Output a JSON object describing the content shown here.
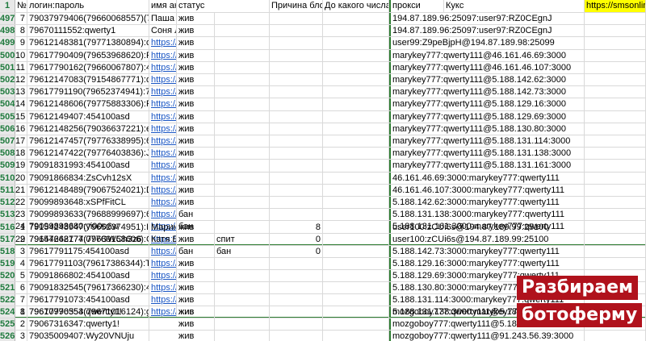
{
  "header": {
    "row_num": "1",
    "num": "№",
    "login": "логин:пароль",
    "name": "имя акка",
    "status": "статус",
    "reason": "Причина блока",
    "until": "До какого числа",
    "proxy": "прокси",
    "cookies": "Кукс",
    "link": "https://smsonline"
  },
  "rows": [
    {
      "rn": "497",
      "num": "7",
      "login": "79037979406(79660068557)(79",
      "name": "Паша",
      "link": "",
      "status": "жив",
      "proxy": "194.87.189.96:25097:user97:RZ0CEgnJ"
    },
    {
      "rn": "498",
      "num": "8",
      "login": "79670111552:qwerty1",
      "name": "Соня Л",
      "link": "",
      "status": "жив",
      "proxy": "194.87.189.96:25097:user97:RZ0CEgnJ"
    },
    {
      "rn": "499",
      "num": "9",
      "login": "79612148381(79771380894):oE",
      "name": "",
      "link": "https://",
      "status": "жив",
      "proxy": "user99:Z9peBjpH@194.87.189.98:25099"
    },
    {
      "rn": "500",
      "num": "10",
      "login": "79617790409(79653968620):Rk",
      "name": "",
      "link": "https://",
      "status": "жив",
      "proxy": "marykey777:qwerty111@46.161.46.69:3000"
    },
    {
      "rn": "501",
      "num": "11",
      "login": "79617790162(79660067807):4g",
      "name": "",
      "link": "https://",
      "status": "жив",
      "proxy": "marykey777:qwerty111@46.161.46.107:3000"
    },
    {
      "rn": "502",
      "num": "12",
      "login": "79612147083(79154867771):qw",
      "name": "",
      "link": "https://",
      "status": "жив",
      "proxy": "marykey777:qwerty111@5.188.142.62:3000"
    },
    {
      "rn": "503",
      "num": "13",
      "login": "79617791190(79652374941):7G",
      "name": "",
      "link": "https://",
      "status": "жив",
      "proxy": "marykey777:qwerty111@5.188.142.73:3000"
    },
    {
      "rn": "504",
      "num": "14",
      "login": "79612148606(79775883306):FX",
      "name": "",
      "link": "https://",
      "status": "жив",
      "proxy": "marykey777:qwerty111@5.188.129.16:3000"
    },
    {
      "rn": "505",
      "num": "15",
      "login": "79612149407:454100asd",
      "name": "",
      "link": "https://",
      "status": "жив",
      "proxy": "marykey777:qwerty111@5.188.129.69:3000"
    },
    {
      "rn": "506",
      "num": "16",
      "login": "79612148256(79036637221):eR",
      "name": "",
      "link": "https://",
      "status": "жив",
      "proxy": "marykey777:qwerty111@5.188.130.80:3000"
    },
    {
      "rn": "507",
      "num": "17",
      "login": "79612147457(79776338995):6O",
      "name": "",
      "link": "https://",
      "status": "жив",
      "proxy": "marykey777:qwerty111@5.188.131.114:3000"
    },
    {
      "rn": "508",
      "num": "18",
      "login": "79612147422(79776403836):Jts",
      "name": "",
      "link": "https://",
      "status": "жив",
      "proxy": "marykey777:qwerty111@5.188.131.138:3000"
    },
    {
      "rn": "509",
      "num": "19",
      "login": "79091831993:454100asd",
      "name": "",
      "link": "https://",
      "status": "жив",
      "proxy": "marykey777:qwerty111@5.188.131.161:3000"
    },
    {
      "rn": "510",
      "num": "20",
      "login": "79091866834:ZsCvh12sX",
      "name": "",
      "link": "https://",
      "status": "жив",
      "proxy": "46.161.46.69:3000:marykey777:qwerty111"
    },
    {
      "rn": "511",
      "num": "21",
      "login": "79612148489(79067524021):D0",
      "name": "",
      "link": "https://",
      "status": "жив",
      "proxy": "46.161.46.107:3000:marykey777:qwerty111"
    },
    {
      "rn": "512",
      "num": "22",
      "login": "79099893648:xSPfFitCL",
      "name": "",
      "link": "https://",
      "status": "жив",
      "proxy": "5.188.142.62:3000:marykey777:qwerty111"
    },
    {
      "rn": "513",
      "num": "23",
      "login": "79099893633(79688999697):6b",
      "name": "",
      "link": "https://",
      "status": "бан",
      "proxy": "5.188.131.138:3000:marykey777:qwerty111"
    },
    {
      "rn": "514",
      "num": "24",
      "login": "79099893680:yi00o6w",
      "name": "",
      "link": "https://",
      "status": "бан",
      "proxy": "5.188.131.161:3000:marykey777:qwerty111"
    },
    {
      "rn": "515",
      "num": "29",
      "login": "79647662774:077GWCh3z6",
      "name": "",
      "link": "https://",
      "status": "",
      "proxy": ""
    }
  ],
  "rows2": [
    {
      "rn": "516",
      "num": "1",
      "login": "79154248947(79652374951):IxA",
      "name": "Марин",
      "link": "",
      "status": "жив",
      "reason": "",
      "until": "8",
      "proxy": "user100:zCUi6s@194.87.189.99:25100"
    },
    {
      "rn": "517",
      "num": "2",
      "login": "79154248177(79689158606):CA",
      "name": "Катя Б",
      "link": "",
      "status": "жив",
      "reason": "спит",
      "until": "0",
      "proxy": "user100:zCUi6s@194.87.189.99:25100"
    },
    {
      "rn": "518",
      "num": "3",
      "login": "79617791175:454100asd",
      "name": "",
      "link": "https://",
      "status": "бан",
      "reason": "бан",
      "until": "0",
      "proxy": "5.188.142.73:3000:marykey777:qwerty111"
    },
    {
      "rn": "519",
      "num": "4",
      "login": "79617791103(79617386344):T9",
      "name": "",
      "link": "https://",
      "status": "жив",
      "reason": "",
      "until": "",
      "proxy": "5.188.129.16:3000:marykey777:qwerty111"
    },
    {
      "rn": "520",
      "num": "5",
      "login": "79091866802:454100asd",
      "name": "",
      "link": "https://",
      "status": "жив",
      "reason": "",
      "until": "",
      "proxy": "5.188.129.69:3000:marykey777:qwerty111"
    },
    {
      "rn": "521",
      "num": "6",
      "login": "79091832545(79617366230):4q",
      "name": "",
      "link": "https://",
      "status": "жив",
      "reason": "",
      "until": "",
      "proxy": "5.188.130.80:3000:marykey777:qwerty111"
    },
    {
      "rn": "522",
      "num": "7",
      "login": "79617791073:454100asd",
      "name": "",
      "link": "https://",
      "status": "жив",
      "reason": "",
      "until": "",
      "proxy": "5.188.131.114:3000:marykey777:qwerty111"
    },
    {
      "rn": "523",
      "num": "8",
      "login": "79617790353(79671016124):gE",
      "name": "",
      "link": "https://",
      "status": "жив",
      "reason": "",
      "until": "",
      "proxy": "5.188.131.138:3000:marykey777:qwerty111"
    }
  ],
  "rows3": [
    {
      "rn": "524",
      "num": "1",
      "login": "79670976554:qwertty1!",
      "name": "",
      "link": "",
      "status": "жив",
      "proxy": "mozgoboy777:qwerty111@5.188.131.161"
    },
    {
      "rn": "525",
      "num": "2",
      "login": "79067316347:qwerty1!",
      "name": "",
      "link": "",
      "status": "жив",
      "proxy": "mozgoboy777:qwerty111@5.188.130.80"
    },
    {
      "rn": "526",
      "num": "3",
      "login": "79035009407:Wy20VNUju",
      "name": "",
      "link": "",
      "status": "жив",
      "proxy": "mozgoboy777:qwerty111@91.243.56.39:3000"
    }
  ],
  "overlay": {
    "line1": "Разбираем",
    "line2": "ботоферму"
  }
}
